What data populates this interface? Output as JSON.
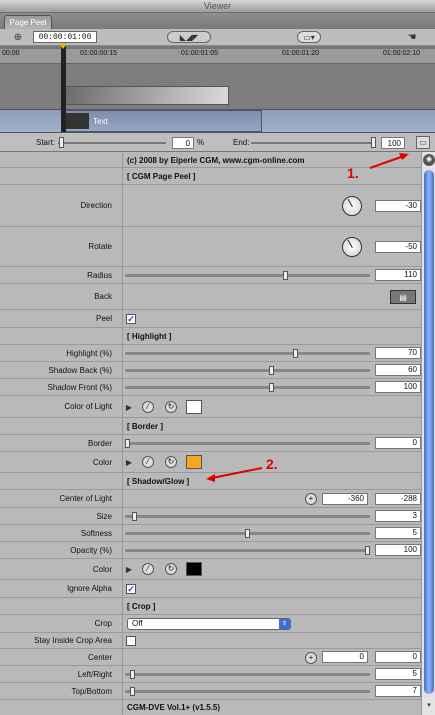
{
  "window": {
    "title": "Viewer",
    "tab": "Page Peel"
  },
  "toolbar": {
    "timecode": "00:00:01:00"
  },
  "ruler": {
    "ticks": [
      "00:00",
      "01:00:00:15",
      "01:00:01:05",
      "01:00:01:20",
      "01:00:02:10"
    ]
  },
  "timeline": {
    "clip_label": "Text"
  },
  "start_end": {
    "start_label": "Start:",
    "start_value": "0",
    "start_unit": "%",
    "end_label": "End:",
    "end_value": "100"
  },
  "params": {
    "copyright": "(c) 2008 by Eiperle CGM,  www.cgm-online.com",
    "section_main": "[ CGM Page Peel ]",
    "direction_label": "Direction",
    "direction_value": "-30",
    "rotate_label": "Rotate",
    "rotate_value": "-50",
    "radius_label": "Radius",
    "radius_value": "110",
    "back_label": "Back",
    "peel_label": "Peel",
    "section_highlight": "[ Highlight ]",
    "highlight_label": "Highlight (%)",
    "highlight_value": "70",
    "shadow_back_label": "Shadow Back (%)",
    "shadow_back_value": "60",
    "shadow_front_label": "Shadow Front (%)",
    "shadow_front_value": "100",
    "color_of_light_label": "Color of Light",
    "section_border": "[ Border ]",
    "border_label": "Border",
    "border_value": "0",
    "color_label": "Color",
    "section_shadow": "[ Shadow/Glow ]",
    "center_light_label": "Center of Light",
    "center_light_x": "-360",
    "center_light_y": "-288",
    "size_label": "Size",
    "size_value": "3",
    "softness_label": "Softness",
    "softness_value": "5",
    "opacity_label": "Opacity (%)",
    "opacity_value": "100",
    "color2_label": "Color",
    "ignore_alpha_label": "Ignore Alpha",
    "section_crop": "[ Crop ]",
    "crop_label": "Crop",
    "crop_value": "Off",
    "stay_inside_label": "Stay Inside Crop Area",
    "center_label": "Center",
    "center_x": "0",
    "center_y": "0",
    "left_right_label": "Left/Right",
    "left_right_value": "5",
    "top_bottom_label": "Top/Bottom",
    "top_bottom_value": "7",
    "footer": "CGM-DVE Vol.1+ (v1.5.5)"
  },
  "annotations": {
    "one": "1.",
    "two": "2."
  },
  "colors": {
    "color_of_light": "#ffffff",
    "border_color": "#f5a623",
    "shadow_color": "#000000",
    "accent": "#3b6fd6",
    "annotation": "#e00000"
  },
  "slider_levels": {
    "radius": 0.66,
    "highlight": 0.7,
    "shadow_back": 0.6,
    "shadow_front": 0.6,
    "border": 0.0,
    "size": 0.03,
    "softness": 0.5,
    "opacity": 1.0,
    "left_right": 0.02,
    "top_bottom": 0.02
  }
}
